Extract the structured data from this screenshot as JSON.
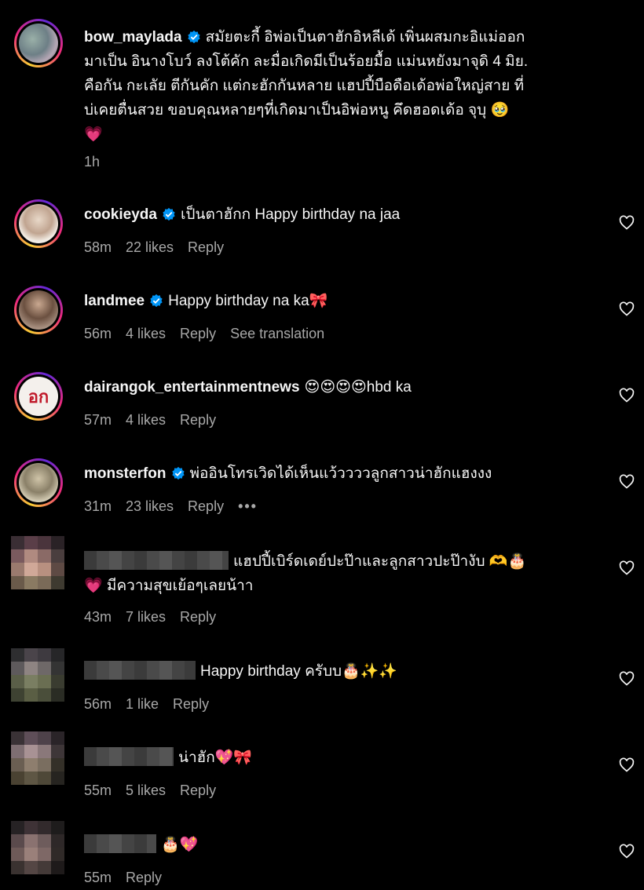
{
  "comments": [
    {
      "username": "bow_maylada",
      "verified": true,
      "lines": [
        "สมัยตะกี้ อิพ่อเป็นตาฮักอิหลีเด้ เพิ่นผสมกะอิแม่ออก",
        "มาเป็น อินางโบว์ ลงโต้คัก ละมื่อเกิดมีเป็นร้อยมื้อ แม่นหยังมาจุดิ 4 มิย.",
        "คือกัน กะเลัย ตีกันคัก แต่กะฮักกันหลาย แฮปปี้บือดือเด้อพ่อใหญ่สาย ที่",
        "บ่เคยตื่นสวย ขอบคุณหลายๆที่เกิดมาเป็นอิพ่อหนู คึดฮอดเด้อ จุบุ 🥹",
        "💗"
      ],
      "time": "1h"
    },
    {
      "username": "cookieyda",
      "verified": true,
      "text": "เป็นตาฮักก Happy birthday na jaa",
      "time": "58m",
      "likes": "22 likes",
      "reply": "Reply"
    },
    {
      "username": "landmee",
      "verified": true,
      "text": "Happy birthday na ka🎀",
      "time": "56m",
      "likes": "4 likes",
      "reply": "Reply",
      "translation": "See translation"
    },
    {
      "username": "dairangok_entertainmentnews",
      "verified": false,
      "text": "😍😍😍😍hbd ka",
      "time": "57m",
      "likes": "4 likes",
      "reply": "Reply",
      "avatar_text": "อก"
    },
    {
      "username": "monsterfon",
      "verified": true,
      "text": "พ่ออินโทรเวิดได้เห็นแว้ววววลูกสาวน่าฮักแฮงงง",
      "time": "31m",
      "likes": "23 likes",
      "reply": "Reply",
      "more": "•••"
    },
    {
      "lines": [
        "แฮปปี้เบิร์ดเดย์ปะป๊าและลูกสาวปะป๊างับ 🫶🎂",
        "💗 มีความสุขเย้อๆเลยน้าา"
      ],
      "time": "43m",
      "likes": "7 likes",
      "reply": "Reply"
    },
    {
      "text": "Happy birthday ครับบ🎂✨✨",
      "time": "56m",
      "likes": "1 like",
      "reply": "Reply"
    },
    {
      "text": "น่าฮัก💖🎀",
      "time": "55m",
      "likes": "5 likes",
      "reply": "Reply"
    },
    {
      "text": "🎂💖",
      "time": "55m",
      "reply": "Reply"
    }
  ],
  "colors": {
    "background": "#000000",
    "text": "#f5f5f5",
    "meta": "#a8a8a8",
    "verified": "#0095f6"
  },
  "icons": {
    "verified": "verified-badge-icon",
    "like": "heart-outline-icon"
  }
}
